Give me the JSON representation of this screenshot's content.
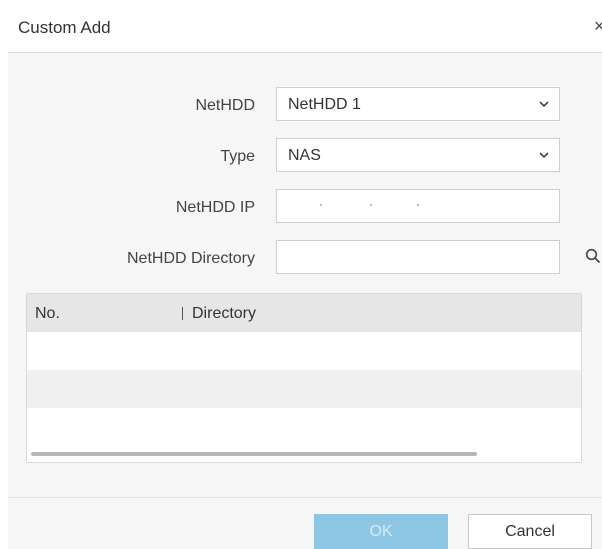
{
  "dialog": {
    "title": "Custom Add",
    "close_glyph": "×"
  },
  "form": {
    "nethdd": {
      "label": "NetHDD",
      "value": "NetHDD 1"
    },
    "type": {
      "label": "Type",
      "value": "NAS"
    },
    "ip": {
      "label": "NetHDD IP",
      "value": ""
    },
    "directory": {
      "label": "NetHDD Directory",
      "value": ""
    }
  },
  "table": {
    "columns": [
      "No.",
      "Directory"
    ],
    "rows": []
  },
  "buttons": {
    "ok": "OK",
    "cancel": "Cancel"
  },
  "colors": {
    "primary_button": "#8ec7e4",
    "header_bg": "#e6e6e6"
  },
  "icons": [
    "close-icon",
    "chevron-down-icon",
    "search-icon"
  ]
}
